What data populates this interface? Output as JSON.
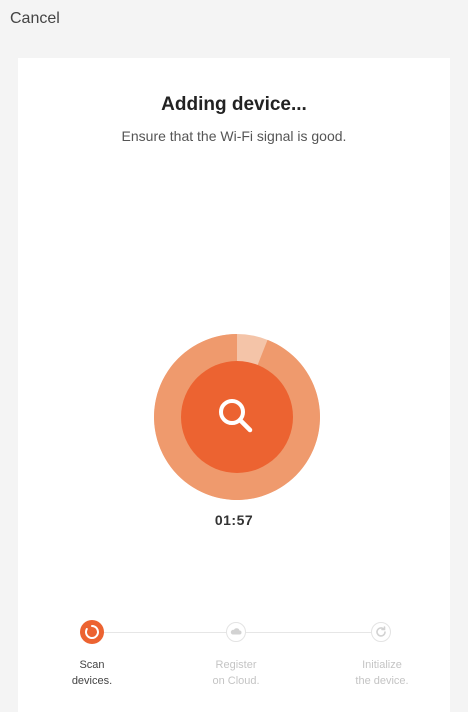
{
  "header": {
    "cancel_label": "Cancel"
  },
  "main": {
    "title": "Adding device...",
    "subtitle": "Ensure that the Wi-Fi signal is good.",
    "progress_fraction": 0.06,
    "timer": "01:57",
    "center_icon": "search-icon"
  },
  "steps": [
    {
      "line1": "Scan",
      "line2": "devices.",
      "state": "active",
      "icon": "loading-ring-icon"
    },
    {
      "line1": "Register",
      "line2": "on Cloud.",
      "state": "pending",
      "icon": "cloud-icon"
    },
    {
      "line1": "Initialize",
      "line2": "the device.",
      "state": "pending",
      "icon": "refresh-icon"
    }
  ],
  "colors": {
    "accent": "#ec6331",
    "ring_light": "#f4c4a8",
    "ring_progress": "#ef9a6d",
    "inactive": "#d2d2d2",
    "background": "#f4f4f4",
    "card": "#ffffff"
  }
}
